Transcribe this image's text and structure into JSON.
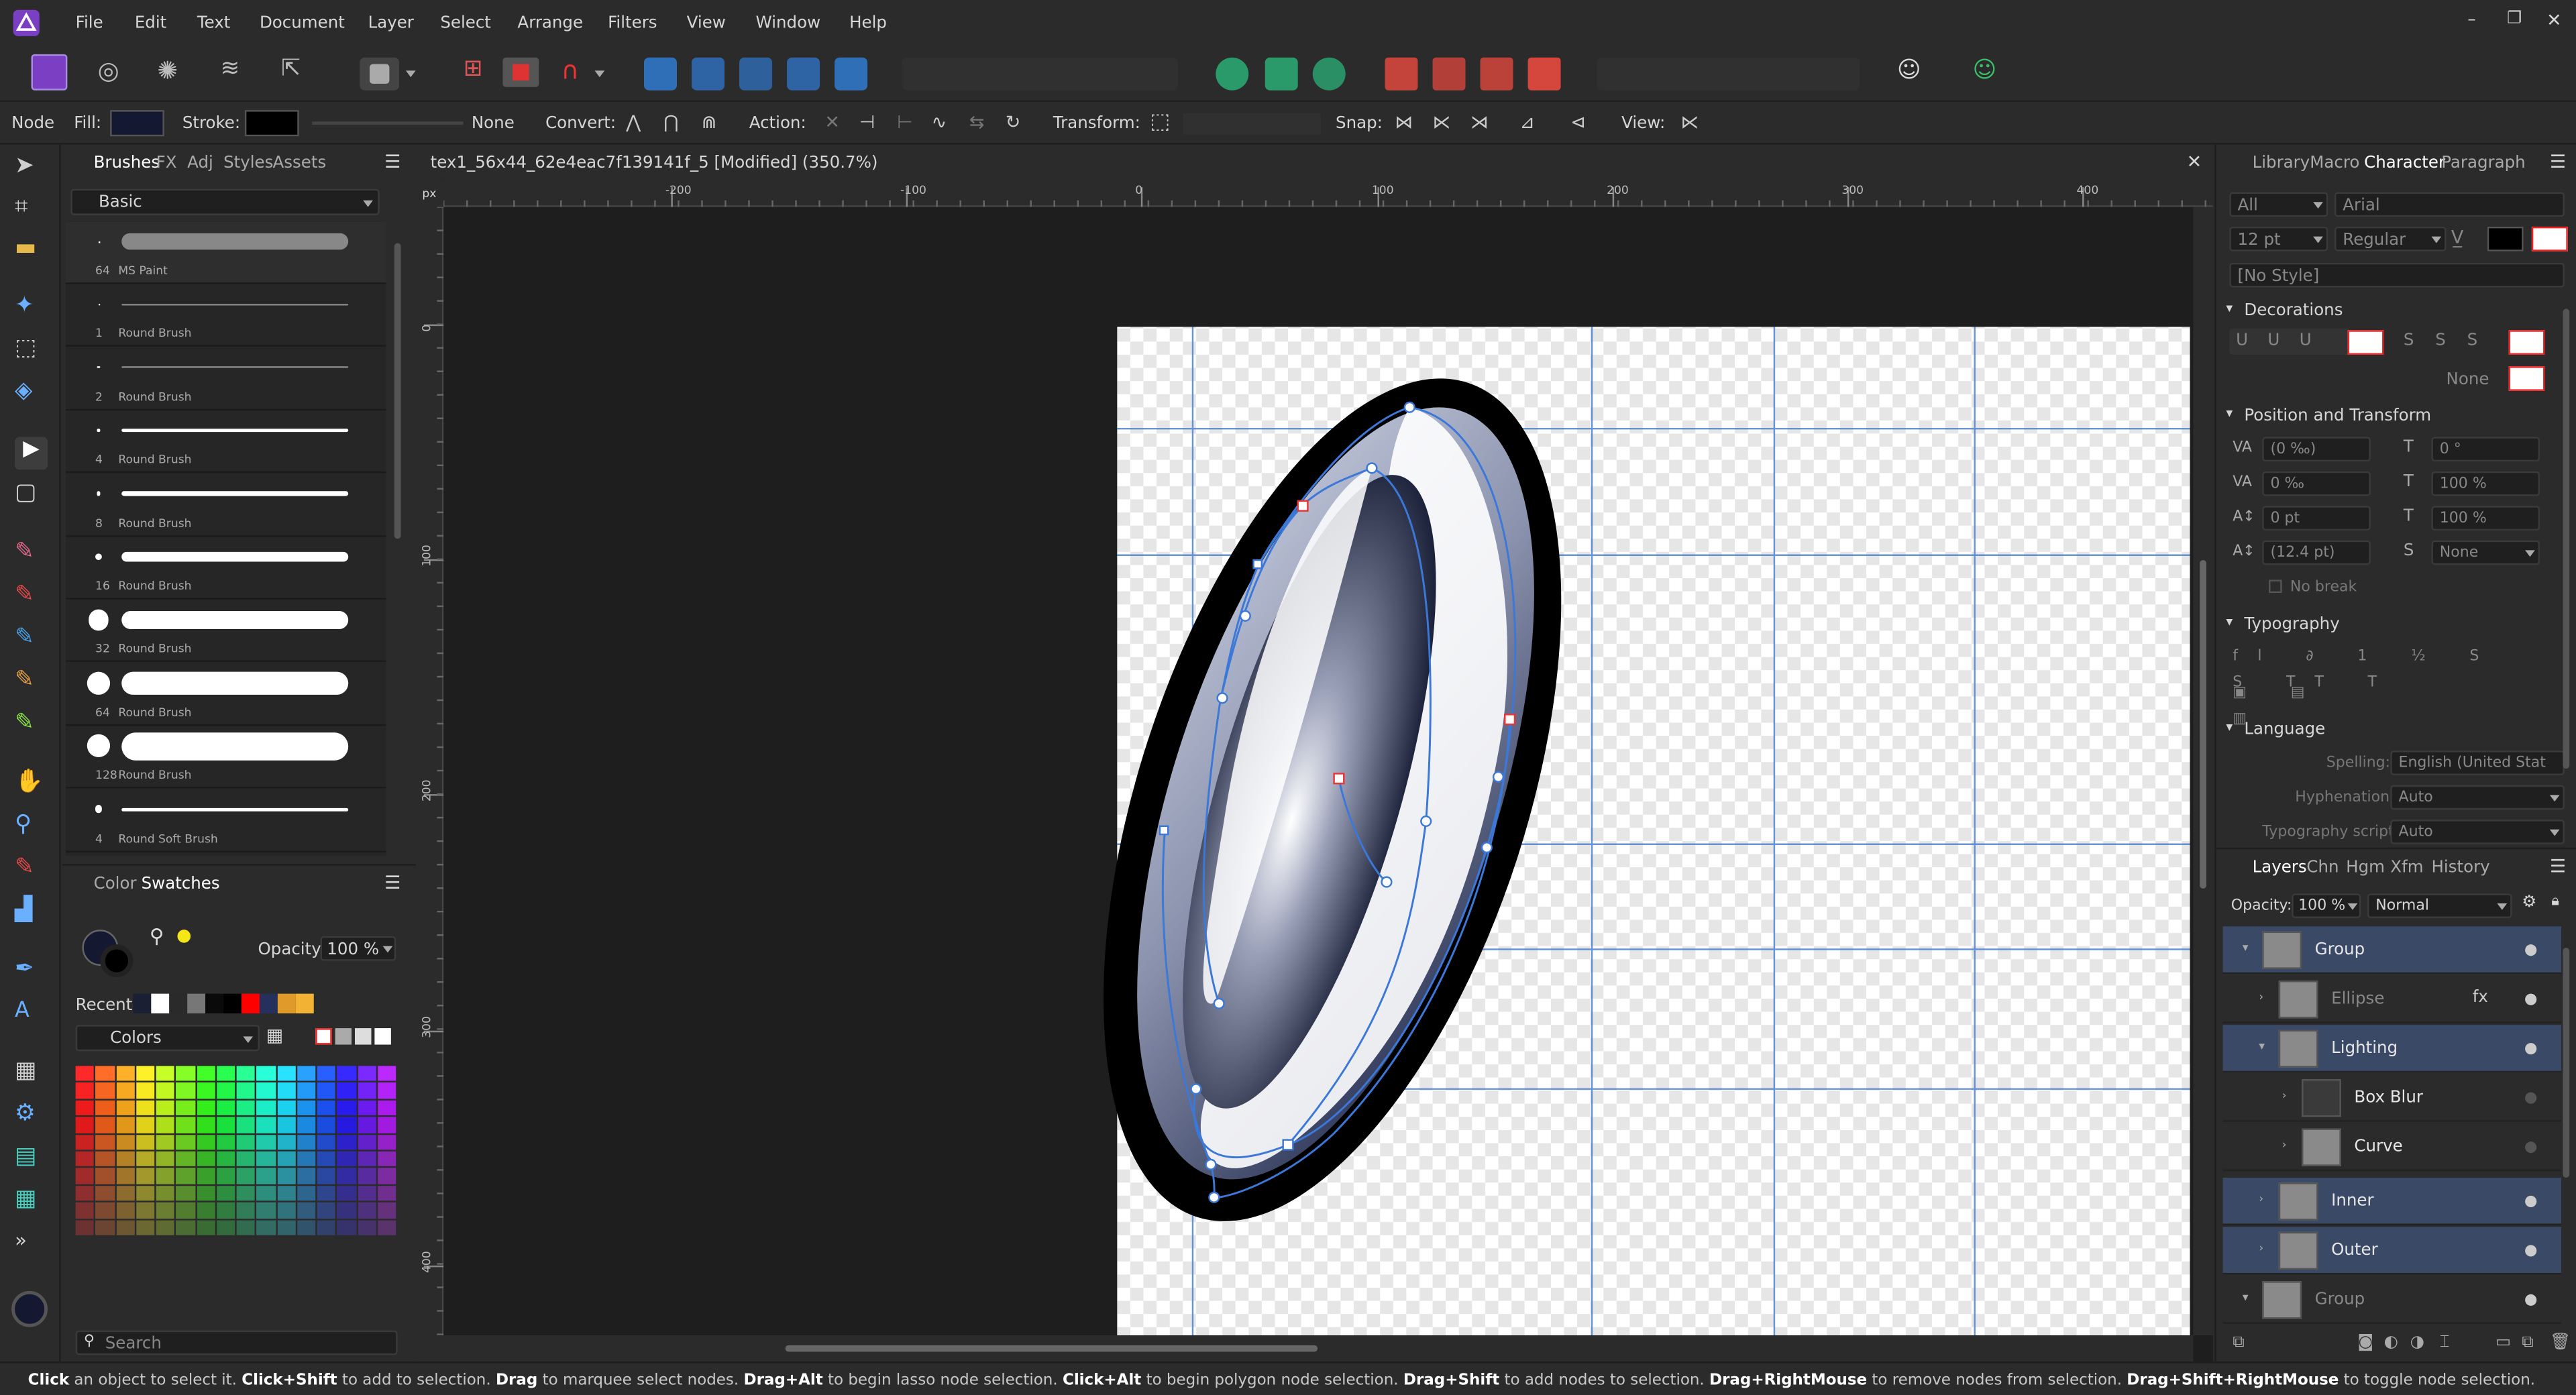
{
  "app": {
    "menu": [
      "File",
      "Edit",
      "Text",
      "Document",
      "Layer",
      "Select",
      "Arrange",
      "Filters",
      "View",
      "Window",
      "Help"
    ]
  },
  "context": {
    "mode": "Node",
    "fill": "Fill:",
    "stroke": "Stroke:",
    "stroke_none": "None",
    "convert": "Convert:",
    "action": "Action:",
    "transform": "Transform:",
    "snap": "Snap:",
    "view": "View:"
  },
  "left_panel": {
    "tabs": [
      "Brushes",
      "FX",
      "Adj",
      "Styles",
      "Assets"
    ],
    "category": "Basic",
    "brushes": [
      {
        "size": "64",
        "name": "MS Paint"
      },
      {
        "size": "1",
        "name": "Round Brush"
      },
      {
        "size": "2",
        "name": "Round Brush"
      },
      {
        "size": "4",
        "name": "Round Brush"
      },
      {
        "size": "8",
        "name": "Round Brush"
      },
      {
        "size": "16",
        "name": "Round Brush"
      },
      {
        "size": "32",
        "name": "Round Brush"
      },
      {
        "size": "64",
        "name": "Round Brush"
      },
      {
        "size": "128",
        "name": "Round Brush"
      },
      {
        "size": "4",
        "name": "Round Soft Brush"
      }
    ]
  },
  "color_panel": {
    "tabs": [
      "Color",
      "Swatches"
    ],
    "opacity_label": "Opacity:",
    "opacity_value": "100 %",
    "recent_label": "Recent:",
    "palette": "Colors",
    "search_placeholder": "Search"
  },
  "document": {
    "tab_title": "tex1_56x44_62e4eac7f139141f_5 [Modified] (350.7%)",
    "ruler_unit": "px",
    "hruler": [
      {
        "v": "-200"
      },
      {
        "v": "-100"
      },
      {
        "v": "0"
      },
      {
        "v": "100"
      },
      {
        "v": "200"
      },
      {
        "v": "300"
      },
      {
        "v": "400"
      }
    ],
    "vruler": [
      {
        "v": "0"
      },
      {
        "v": "100"
      },
      {
        "v": "200"
      },
      {
        "v": "300"
      },
      {
        "v": "400"
      }
    ]
  },
  "right_panel": {
    "tabs": [
      "Library",
      "Macro",
      "Character",
      "Paragraph"
    ],
    "font_collection": "All",
    "font_family": "Arial",
    "font_size": "12 pt",
    "font_weight": "Regular",
    "style": "[No Style]",
    "decorations": {
      "header": "Decorations",
      "none": "None"
    },
    "position": {
      "header": "Position and Transform",
      "kerning": "(0 ‰)",
      "rotation": "0 °",
      "tracking": "0 ‰",
      "hscale": "100 %",
      "baseline": "0 pt",
      "vscale": "100 %",
      "leading": "(12.4 pt)",
      "shear": "None",
      "nobreak": "No break"
    },
    "typography": {
      "header": "Typography"
    },
    "language": {
      "header": "Language",
      "spelling_label": "Spelling:",
      "spelling": "English (United Stat",
      "hyphen_label": "Hyphenation:",
      "hyphen": "Auto",
      "script_label": "Typography script:",
      "script": "Auto"
    }
  },
  "layers_panel": {
    "tabs": [
      "Layers",
      "Chn",
      "Hgm",
      "Xfm",
      "History"
    ],
    "opacity_label": "Opacity:",
    "opacity": "100 %",
    "blend": "Normal",
    "layers": [
      {
        "name": "Group"
      },
      {
        "name": "Ellipse"
      },
      {
        "name": "Lighting"
      },
      {
        "name": "Box Blur"
      },
      {
        "name": "Curve"
      },
      {
        "name": "Inner"
      },
      {
        "name": "Outer"
      },
      {
        "name": "Group"
      }
    ]
  },
  "status": {
    "segments": [
      {
        "b": "Click",
        "t": " an object to select it. "
      },
      {
        "b": "Click+Shift",
        "t": " to add to selection. "
      },
      {
        "b": "Drag",
        "t": " to marquee select nodes. "
      },
      {
        "b": "Drag+Alt",
        "t": " to begin lasso node selection. "
      },
      {
        "b": "Click+Alt",
        "t": " to begin polygon node selection. "
      },
      {
        "b": "Drag+Shift",
        "t": " to add nodes to selection. "
      },
      {
        "b": "Drag+RightMouse",
        "t": " to remove nodes from selection. "
      },
      {
        "b": "Drag+Shift+RightMouse",
        "t": " to toggle node selection."
      }
    ]
  },
  "colors": {
    "accent": "#2f6fb8",
    "panel": "#2b2b2b",
    "canvas_bg": "#1e1e1e",
    "layer_selected": "#3a4a66",
    "recent": [
      "#1b1f33",
      "#ffffff",
      "#2a2a2a",
      "#777777",
      "#0a0a0a",
      "#000000",
      "#ff0000",
      "#25315c",
      "#e09a2a",
      "#f2b233"
    ]
  }
}
